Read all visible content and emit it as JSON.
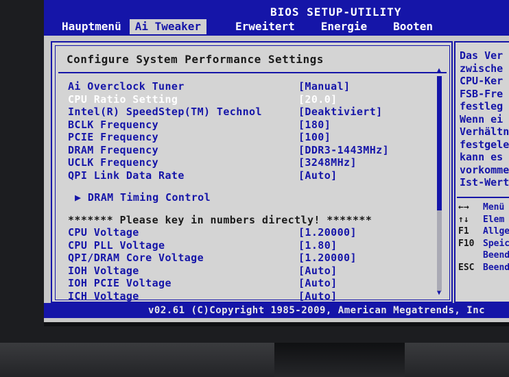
{
  "app": {
    "title": "BIOS SETUP-UTILITY"
  },
  "tabs": [
    {
      "label": "Hauptmenü"
    },
    {
      "label": "Ai Tweaker"
    },
    {
      "label": "Erweitert"
    },
    {
      "label": "Energie"
    },
    {
      "label": "Booten"
    }
  ],
  "main": {
    "title": "Configure System Performance Settings",
    "rows_top": [
      {
        "label": "Ai Overclock Tuner",
        "value": "[Manual]"
      },
      {
        "label": "CPU Ratio Setting",
        "value": "[20.0]"
      },
      {
        "label": "Intel(R) SpeedStep(TM) Technol",
        "value": "[Deaktiviert]"
      },
      {
        "label": "BCLK Frequency",
        "value": "[180]"
      },
      {
        "label": "PCIE Frequency",
        "value": "[100]"
      },
      {
        "label": "DRAM Frequency",
        "value": "[DDR3-1443MHz]"
      },
      {
        "label": "UCLK Frequency",
        "value": "[3248MHz]"
      },
      {
        "label": "QPI Link Data Rate",
        "value": "[Auto]"
      }
    ],
    "submenu": {
      "label": "▶ DRAM Timing Control"
    },
    "notice": "******* Please key in numbers directly! *******",
    "rows_voltage": [
      {
        "label": "CPU Voltage",
        "value": "[1.20000]"
      },
      {
        "label": "CPU PLL Voltage",
        "value": "[1.80]"
      },
      {
        "label": "QPI/DRAM Core Voltage",
        "value": "[1.20000]"
      },
      {
        "label": "IOH Voltage",
        "value": "[Auto]"
      },
      {
        "label": "IOH PCIE Voltage",
        "value": "[Auto]"
      },
      {
        "label": "ICH Voltage",
        "value": "[Auto]"
      }
    ]
  },
  "help": {
    "lines": [
      "Das Ver",
      "zwische",
      "CPU-Ker",
      "FSB-Fre",
      "festleg",
      "Wenn ei",
      "Verhältn",
      "festgele",
      "kann es",
      "vorkommen",
      "Ist-Wert"
    ],
    "keys": [
      {
        "key": "←→",
        "desc": "Menü"
      },
      {
        "key": "↑↓",
        "desc": "Elem"
      },
      {
        "key": "F1",
        "desc": "Allge"
      },
      {
        "key": "F10",
        "desc": "Speic"
      },
      {
        "key": "",
        "desc": "Beende"
      },
      {
        "key": "ESC",
        "desc": "Beend"
      }
    ]
  },
  "footer": {
    "text": "v02.61 (C)Copyright 1985-2009, American Megatrends, Inc"
  },
  "colors": {
    "bios_blue": "#1515a8",
    "panel_gray": "#d4d4d4",
    "highlight": "#ffffff"
  }
}
